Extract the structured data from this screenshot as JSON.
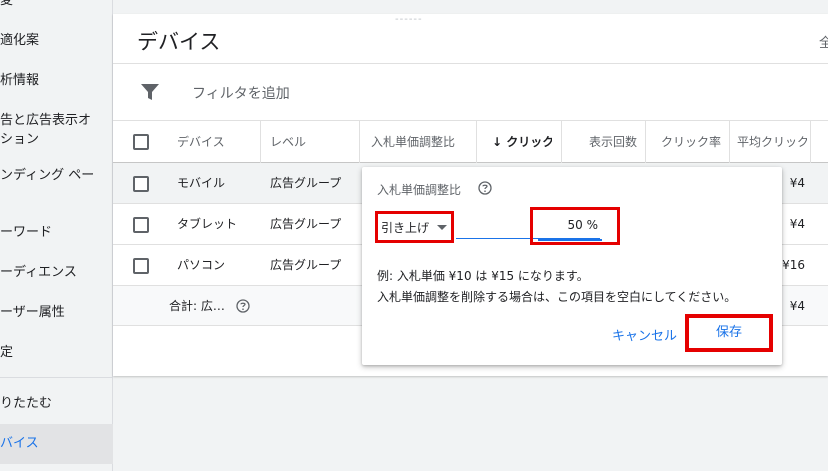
{
  "sidebar": {
    "items": [
      {
        "label": "変"
      },
      {
        "label": "適化案"
      },
      {
        "label": "析情報"
      },
      {
        "label": "告と広告表示オ",
        "label2": "ション"
      },
      {
        "label": "ンディング ペー",
        "label2": " "
      },
      {
        "label": "ーワード"
      },
      {
        "label": "ーディエンス"
      },
      {
        "label": "ーザー属性"
      },
      {
        "label": "定"
      },
      {
        "label": "りたたむ"
      },
      {
        "label": "バイス"
      }
    ]
  },
  "main": {
    "top_dash": "------",
    "title": "デバイス",
    "title_right": "全",
    "filter_label": "フィルタを追加"
  },
  "table": {
    "headers": {
      "device": "デバイス",
      "level": "レベル",
      "bid_adj": "入札単価調整比",
      "clicks": "↓ クリック",
      "impressions": "表示回数",
      "ctr": "クリック率",
      "avg_cpc": "平均クリック"
    },
    "rows": [
      {
        "device": "モバイル",
        "level": "広告グループ",
        "avg_cpc": "¥4"
      },
      {
        "device": "タブレット",
        "level": "広告グループ",
        "avg_cpc": "¥4"
      },
      {
        "device": "パソコン",
        "level": "広告グループ",
        "avg_cpc": "¥16"
      }
    ],
    "total": {
      "label": "合計: 広…",
      "avg_cpc": "¥4"
    }
  },
  "popup": {
    "label": "入札単価調整比",
    "direction": "引き上げ",
    "value": "50 %",
    "example": "例: 入札単価 ¥10 は ¥15 になります。",
    "note": "入札単価調整を削除する場合は、この項目を空白にしてください。",
    "cancel_label": "キャンセル",
    "save_label": "保存"
  },
  "colors": {
    "accent": "#1a73e8",
    "highlight": "#e50000"
  }
}
